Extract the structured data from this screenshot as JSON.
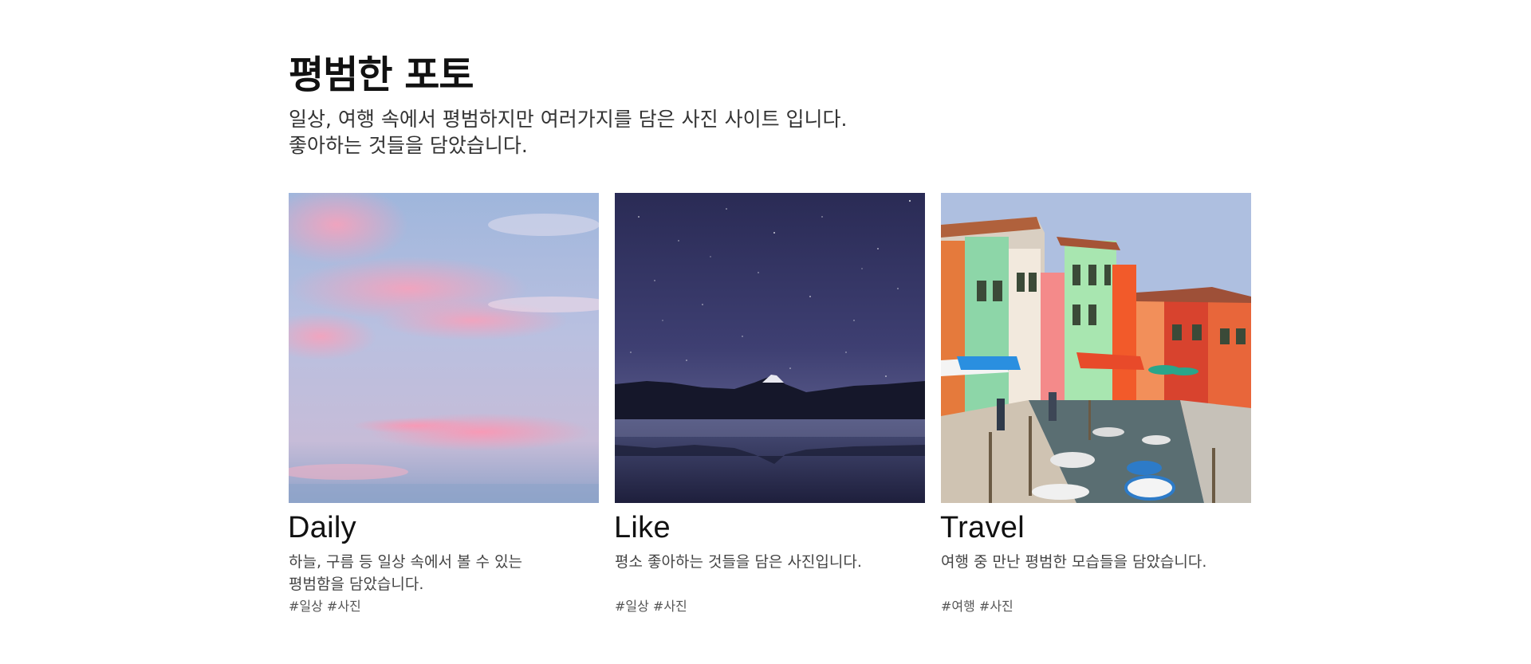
{
  "header": {
    "title": "평범한 포토",
    "intro_line1": "일상, 여행 속에서 평범하지만 여러가지를 담은 사진 사이트 입니다.",
    "intro_line2": "좋아하는 것들을 담았습니다."
  },
  "cards": [
    {
      "title": "Daily",
      "desc_line1": "하늘, 구름 등 일상 속에서 볼 수 있는",
      "desc_line2": "평범함을 담았습니다.",
      "tags": "#일상 #사진",
      "image_icon": "pink-sky-clouds-photo"
    },
    {
      "title": "Like",
      "desc_line1": "평소 좋아하는 것들을 담은 사진입니다.",
      "desc_line2": "",
      "tags": "#일상 #사진",
      "image_icon": "night-mountain-lake-photo"
    },
    {
      "title": "Travel",
      "desc_line1": "여행 중 만난 평범한 모습들을 담았습니다.",
      "desc_line2": "",
      "tags": "#여행 #사진",
      "image_icon": "colorful-canal-houses-photo"
    }
  ]
}
